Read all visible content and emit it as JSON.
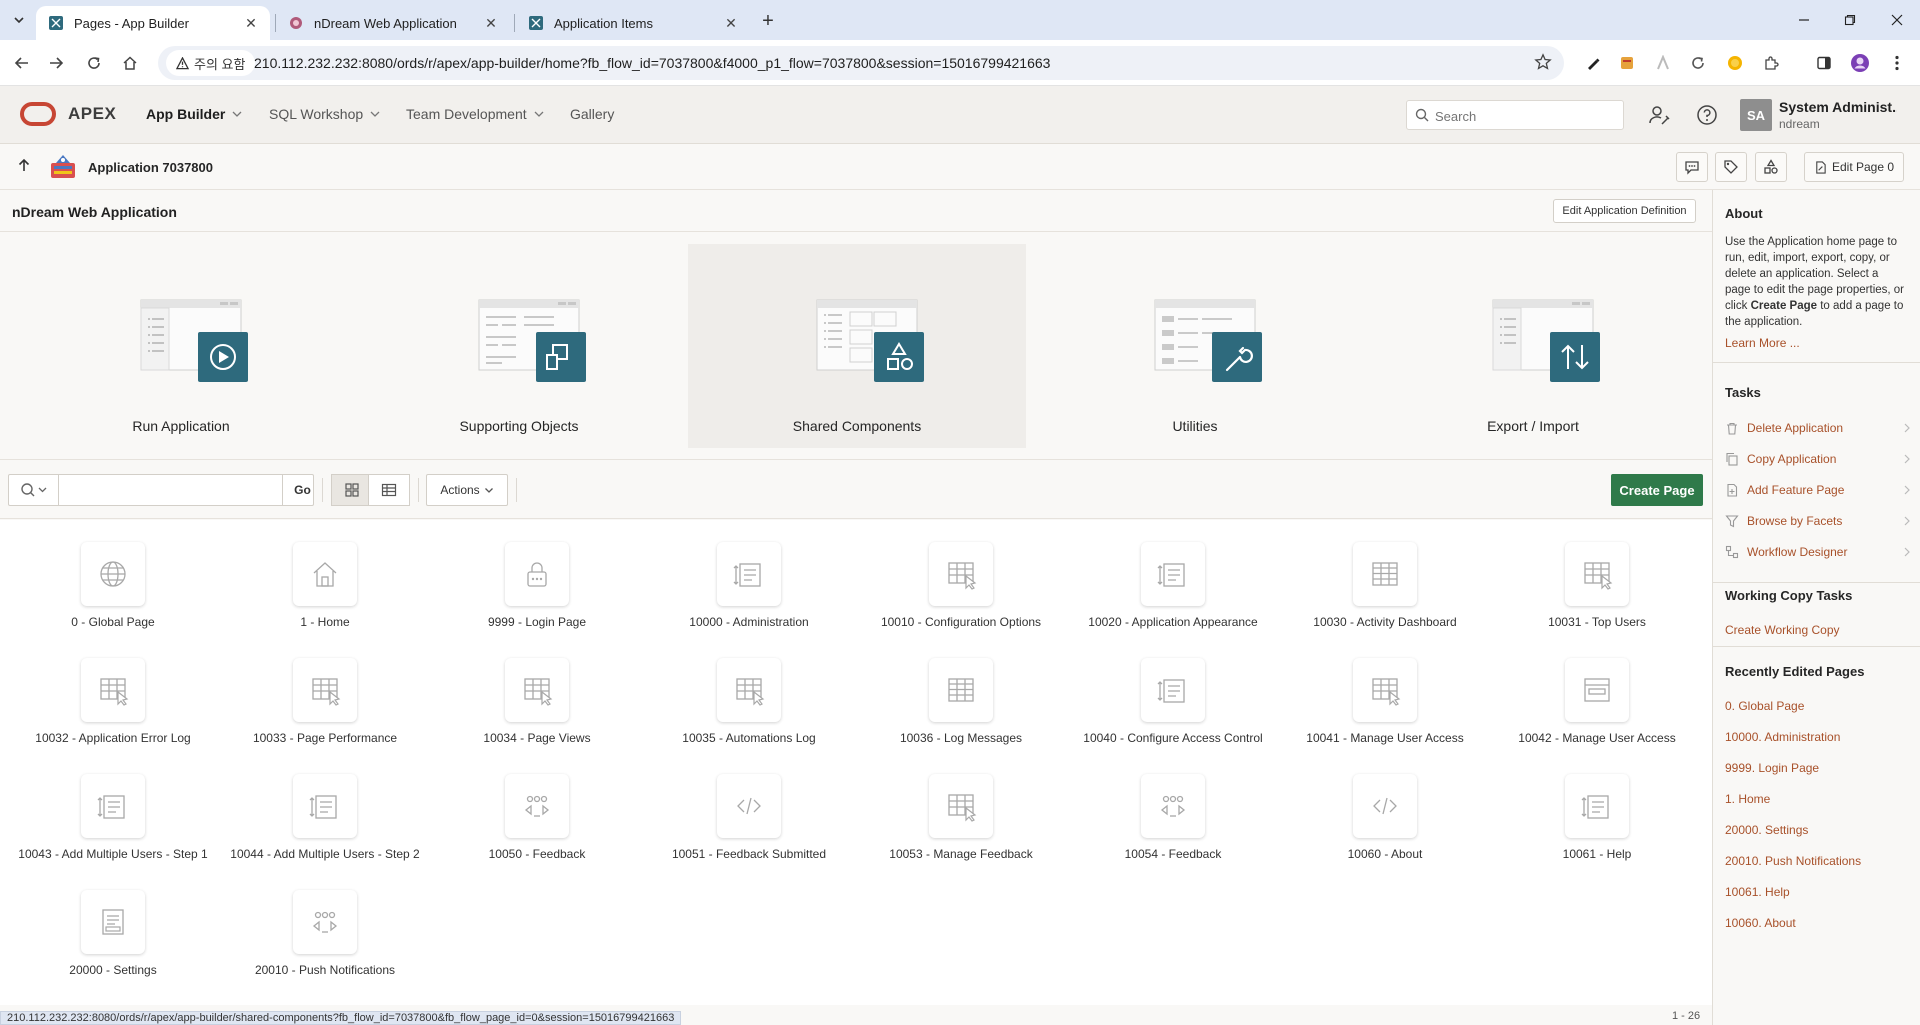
{
  "browser": {
    "tabs": [
      {
        "label": "Pages - App Builder",
        "active": true
      },
      {
        "label": "nDream Web Application",
        "active": false
      },
      {
        "label": "Application Items",
        "active": false
      }
    ],
    "security_label": "주의 요함",
    "url": "210.112.232.232:8080/ords/r/apex/app-builder/home?fb_flow_id=7037800&f4000_p1_flow=7037800&session=15016799421663"
  },
  "header": {
    "logo": "APEX",
    "nav": [
      {
        "label": "App Builder",
        "selected": true
      },
      {
        "label": "SQL Workshop",
        "selected": false
      },
      {
        "label": "Team Development",
        "selected": false
      },
      {
        "label": "Gallery",
        "selected": false
      }
    ],
    "search_placeholder": "Search",
    "avatar_initials": "SA",
    "user_name": "System Administ...",
    "workspace": "ndream"
  },
  "breadcrumb": {
    "title": "Application 7037800",
    "edit_page_label": "Edit Page 0"
  },
  "main": {
    "app_title": "nDream Web Application",
    "edit_definition_label": "Edit Application Definition",
    "hero": [
      {
        "label": "Run Application",
        "icon": "play-icon"
      },
      {
        "label": "Supporting Objects",
        "icon": "install-icon"
      },
      {
        "label": "Shared Components",
        "icon": "shapes-icon",
        "highlighted": true
      },
      {
        "label": "Utilities",
        "icon": "wrench-icon"
      },
      {
        "label": "Export / Import",
        "icon": "arrows-updown-icon"
      }
    ],
    "toolbar": {
      "go_label": "Go",
      "actions_label": "Actions",
      "create_page_label": "Create Page"
    },
    "pages": [
      {
        "label": "0 - Global Page",
        "icon": "globe-icon"
      },
      {
        "label": "1 - Home",
        "icon": "home-icon"
      },
      {
        "label": "9999 - Login Page",
        "icon": "lock-icon"
      },
      {
        "label": "10000 - Administration",
        "icon": "wizard-icon"
      },
      {
        "label": "10010 - Configuration Options",
        "icon": "report-cursor-icon"
      },
      {
        "label": "10020 - Application Appearance",
        "icon": "wizard-icon"
      },
      {
        "label": "10030 - Activity Dashboard",
        "icon": "grid-icon"
      },
      {
        "label": "10031 - Top Users",
        "icon": "report-cursor-icon"
      },
      {
        "label": "10032 - Application Error Log",
        "icon": "report-cursor-icon"
      },
      {
        "label": "10033 - Page Performance",
        "icon": "report-cursor-icon"
      },
      {
        "label": "10034 - Page Views",
        "icon": "report-cursor-icon"
      },
      {
        "label": "10035 - Automations Log",
        "icon": "report-cursor-icon"
      },
      {
        "label": "10036 - Log Messages",
        "icon": "grid-icon"
      },
      {
        "label": "10040 - Configure Access Control",
        "icon": "wizard-icon"
      },
      {
        "label": "10041 - Manage User Access",
        "icon": "report-cursor-icon"
      },
      {
        "label": "10042 - Manage User Access",
        "icon": "form-icon"
      },
      {
        "label": "10043 - Add Multiple Users - Step 1",
        "icon": "wizard-icon"
      },
      {
        "label": "10044 - Add Multiple Users - Step 2",
        "icon": "wizard-icon"
      },
      {
        "label": "10050 - Feedback",
        "icon": "carousel-icon"
      },
      {
        "label": "10051 - Feedback Submitted",
        "icon": "code-icon"
      },
      {
        "label": "10053 - Manage Feedback",
        "icon": "report-cursor-icon"
      },
      {
        "label": "10054 - Feedback",
        "icon": "carousel-icon"
      },
      {
        "label": "10060 - About",
        "icon": "code-icon"
      },
      {
        "label": "10061 - Help",
        "icon": "wizard-icon"
      },
      {
        "label": "20000 - Settings",
        "icon": "settings-page-icon"
      },
      {
        "label": "20010 - Push Notifications",
        "icon": "carousel-icon"
      }
    ],
    "pagination": "1 - 26"
  },
  "sidebar": {
    "about_heading": "About",
    "about_text_1": "Use the Application home page to run, edit, import, export, copy, or delete an application. Select a page to edit the page properties, or click ",
    "about_text_bold": "Create Page",
    "about_text_2": " to add a page to the application.",
    "learn_more": "Learn More ...",
    "tasks_heading": "Tasks",
    "tasks": [
      {
        "label": "Delete Application"
      },
      {
        "label": "Copy Application"
      },
      {
        "label": "Add Feature Page"
      },
      {
        "label": "Browse by Facets"
      },
      {
        "label": "Workflow Designer"
      }
    ],
    "working_copy_heading": "Working Copy Tasks",
    "working_copy_link": "Create Working Copy",
    "recent_heading": "Recently Edited Pages",
    "recent": [
      "0. Global Page",
      "10000. Administration",
      "9999. Login Page",
      "1. Home",
      "20000. Settings",
      "20010. Push Notifications",
      "10061. Help",
      "10060. About"
    ]
  },
  "status_bar_url": "210.112.232.232:8080/ords/r/apex/app-builder/shared-components?fb_flow_id=7037800&fb_flow_page_id=0&session=15016799421663",
  "colors": {
    "accent": "#a8512a",
    "create_button": "#2f7a4a",
    "tile_icon": "#2e6a7d",
    "logo": "#c74634"
  }
}
